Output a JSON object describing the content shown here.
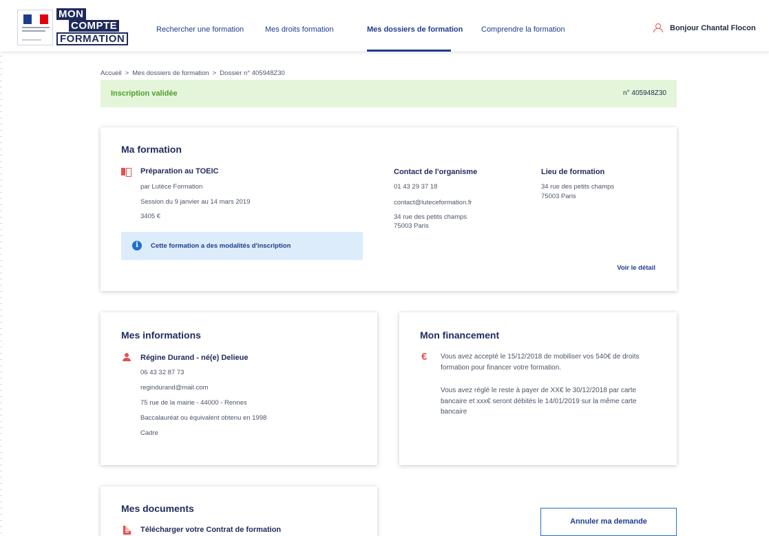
{
  "header": {
    "nav": [
      {
        "label": "Rechercher une formation",
        "active": false
      },
      {
        "label": "Mes droits formation",
        "active": false
      },
      {
        "label": "Mes dossiers de formation",
        "active": true
      },
      {
        "label": "Comprendre la formation",
        "active": false
      }
    ],
    "logo_words": [
      "MON",
      "COMPTE",
      "FORMATION"
    ],
    "user_greeting": "Bonjour Chantal Flocon"
  },
  "breadcrumb": [
    "Accueil",
    "Mes dossiers de formation",
    "Dossier n° 405948Z30"
  ],
  "breadcrumb_separator": ">",
  "status": {
    "label": "Inscription validée",
    "number": "n° 405948Z30"
  },
  "formation": {
    "title": "Ma formation",
    "name": "Préparation au TOEIC",
    "organizer": "par Lutèce Formation",
    "session": "Session du 9 janvier au 14 mars 2019",
    "price": "3405 €",
    "info": "Cette formation a des modalités d'inscription",
    "contact": {
      "heading": "Contact de l'organisme",
      "phone": "01 43 29 37 18",
      "email": "contact@luteceformation.fr",
      "address_line1": "34 rue des petits champs",
      "address_line2": "75003 Paris"
    },
    "lieu": {
      "heading": "Lieu de formation",
      "address_line1": "34 rue des petits champs",
      "address_line2": "75003 Paris"
    },
    "detail_link": "Voir le détail"
  },
  "infos": {
    "title": "Mes informations",
    "name": "Régine Durand  - né(e) Delieue",
    "phone": "06 43 32 87 73",
    "email": "regindurand@mail.com",
    "address": "75 rue de la mairie - 44000 - Rennes",
    "diploma": "Baccalauréat ou équivalent obtenu en 1998",
    "status": "Cadre"
  },
  "financement": {
    "title": "Mon financement",
    "p1": "Vous avez accepté le 15/12/2018 de mobiliser vos 540€ de droits formation pour financer votre formation.",
    "p2": "Vous avez réglé le reste à payer  de XX€ le 30/12/2018 par carte bancaire et xxx€ seront débités le 14/01/2019 sur la même carte bancaire"
  },
  "documents": {
    "title": "Mes documents",
    "link": "Télécharger votre Contrat de formation"
  },
  "cancel_button": "Annuler ma demande",
  "colors": {
    "accent": "#1f3b8f",
    "brand": "#1f2a5c",
    "red": "#e84f4f",
    "success_bg": "#e4f5d9",
    "success_text": "#4ba12b",
    "info_bg": "#dcecfa"
  }
}
